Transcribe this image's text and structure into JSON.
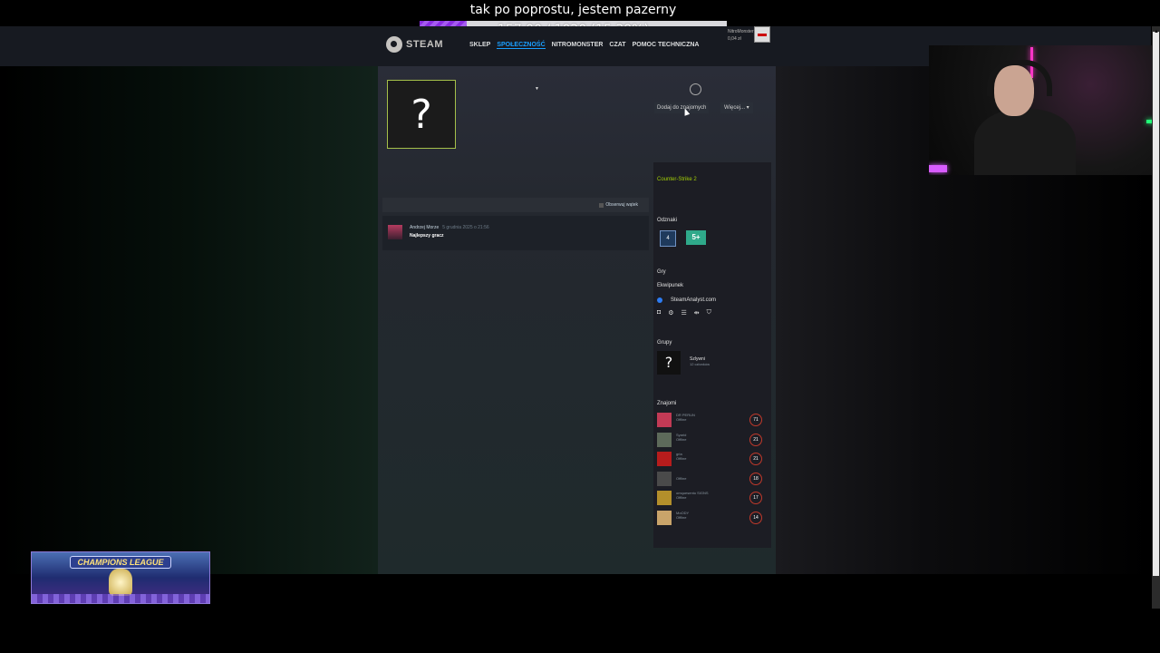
{
  "stream": {
    "title": "tak po poprostu, jestem pazerny",
    "progress_text": "157.00 / 1020 (15.39%)",
    "progress_fraction": 0.1539
  },
  "header": {
    "brand": "STEAM",
    "nav": [
      "SKLEP",
      "SPOŁECZNOŚĆ",
      "NITROMONSTER",
      "CZAT",
      "POMOC TECHNICZNA"
    ],
    "active_nav": "SPOŁECZNOŚĆ",
    "account_name": "NitroMonster ▾",
    "wallet": "0,04 zł"
  },
  "profile": {
    "avatar_glyph": "?",
    "add_friend_label": "Dodaj do znajomych",
    "more_label": "Więcej... ▾"
  },
  "comments": {
    "follow_label": "Obserwuj wątek",
    "items": [
      {
        "author": "Andrzej Morze",
        "date": "5 grudnia 2025 o 21:56",
        "text": "Najlepszy gracz"
      }
    ]
  },
  "sidebar": {
    "game": "Counter-Strike 2",
    "badges_title": "Odznaki",
    "badges": [
      "4",
      "5+"
    ],
    "games_title": "Gry",
    "inventory_title": "Ekwipunek",
    "steamanalyst": "SteamAnalyst.com",
    "inventory_icons": [
      "◘",
      "⚙",
      "☰",
      "⇹",
      "⛉"
    ],
    "groups_title": "Grupy",
    "group": {
      "name": "Szlywni",
      "members": "12 członków"
    },
    "friends_title": "Znajomi",
    "friends": [
      {
        "name": "DR PERUN",
        "status": "Offline",
        "level": "71",
        "color": "#c23a55"
      },
      {
        "name": "Syarid",
        "status": "Offline",
        "level": "21",
        "color": "#5d6a5a"
      },
      {
        "name": "grla",
        "status": "Offline",
        "level": "21",
        "color": "#b71c1c"
      },
      {
        "name": "",
        "status": "Offline",
        "level": "18",
        "color": "#4a4a4a"
      },
      {
        "name": "omquesento SIGNS",
        "status": "Offline",
        "level": "17",
        "color": "#b38f2b"
      },
      {
        "name": "MoODY",
        "status": "Offline",
        "level": "14",
        "color": "#c9a46a"
      }
    ]
  },
  "overlay": {
    "champions_label": "CHAMPIONS LEAGUE"
  }
}
